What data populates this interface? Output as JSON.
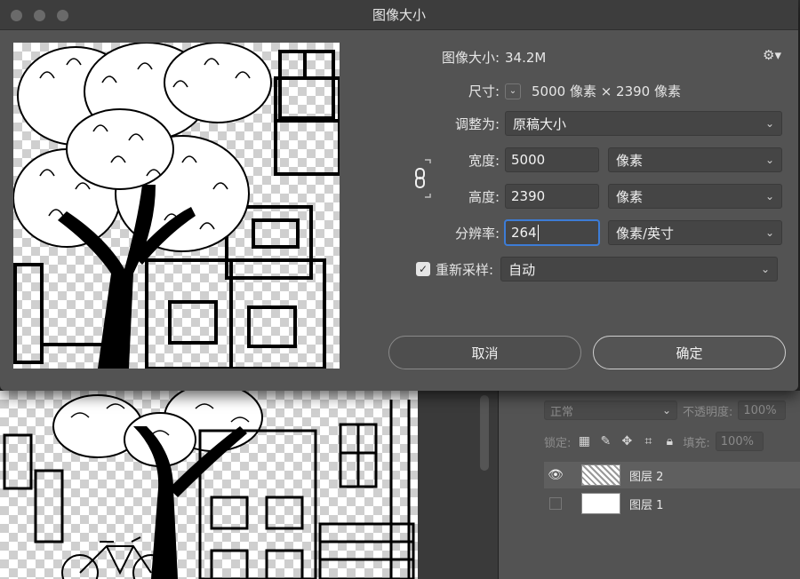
{
  "dialog": {
    "title": "图像大小",
    "image_size_label": "图像大小:",
    "image_size_value": "34.2M",
    "dimensions_label": "尺寸:",
    "dimensions_value": "5000 像素  ×  2390 像素",
    "fit_to_label": "调整为:",
    "fit_to_value": "原稿大小",
    "width_label": "宽度:",
    "width_value": "5000",
    "width_unit": "像素",
    "height_label": "高度:",
    "height_value": "2390",
    "height_unit": "像素",
    "resolution_label": "分辨率:",
    "resolution_value": "264",
    "resolution_unit": "像素/英寸",
    "resample_label": "重新采样:",
    "resample_value": "自动",
    "cancel_label": "取消",
    "ok_label": "确定"
  },
  "layers_panel": {
    "blend_mode": "正常",
    "opacity_label": "不透明度:",
    "opacity_value": "100%",
    "lock_label": "锁定:",
    "fill_label": "填充:",
    "fill_value": "100%",
    "layers": [
      {
        "name": "图层 2",
        "visible": true,
        "active": true
      },
      {
        "name": "图层 1",
        "visible": false,
        "active": false
      }
    ]
  },
  "icons": {
    "gear": "gear-icon",
    "link": "link-icon",
    "chevron": "chevron-down-icon",
    "eye": "eye-icon",
    "check": "checkmark-icon"
  },
  "colors": {
    "dialog_bg": "#535353",
    "focus_ring": "#3d7cd6"
  }
}
